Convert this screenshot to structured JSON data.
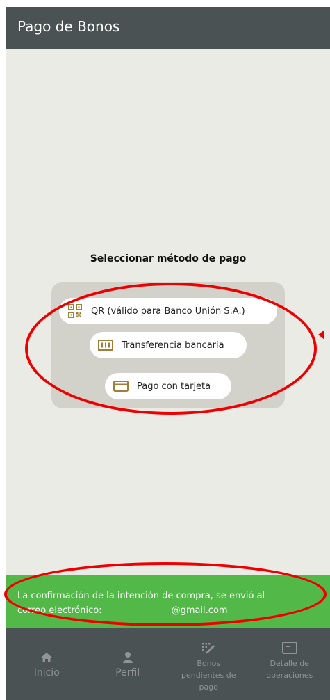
{
  "appbar": {
    "title": "Pago de Bonos"
  },
  "payment": {
    "heading": "Seleccionar método de pago",
    "methods": [
      {
        "label": "QR  (válido para Banco Unión S.A.)",
        "icon": "qr-code-icon"
      },
      {
        "label": "Transferencia bancaria",
        "icon": "bank-transfer-icon"
      },
      {
        "label": "Pago con tarjeta",
        "icon": "credit-card-icon"
      }
    ]
  },
  "notice": {
    "line1": "La confirmación de la intención de compra, se envió al",
    "line2_prefix": "correo electrónico:",
    "line2_email": "@gmail.com"
  },
  "nav": {
    "items": [
      {
        "label": "Inicio",
        "icon": "home-icon"
      },
      {
        "label": "Perfil",
        "icon": "person-icon"
      },
      {
        "label": "Bonos pendientes de pago",
        "icon": "pending-bonds-icon"
      },
      {
        "label": "Detalle de operaciones",
        "icon": "operations-detail-icon"
      }
    ]
  },
  "colors": {
    "appbar": "#4b5253",
    "background": "#ebebe6",
    "panel": "#d2d2cb",
    "icon_accent": "#a07e35",
    "notice": "#52b848",
    "annotation": "#ee0000",
    "nav_inactive": "#8f9495"
  }
}
